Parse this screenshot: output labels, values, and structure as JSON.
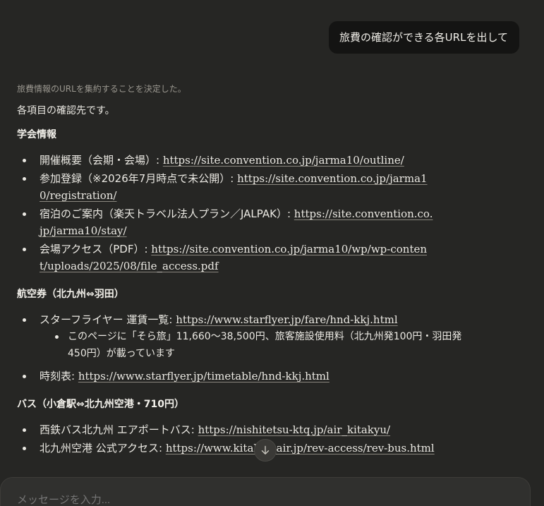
{
  "user_message": "旅費の確認ができる各URLを出して",
  "assistant": {
    "thinking_summary": "旅費情報のURLを集約することを決定した。",
    "intro": "各項目の確認先です。",
    "sections": [
      {
        "heading": "学会情報",
        "items": [
          {
            "label": "開催概要（会期・会場）: ",
            "url": "https://site.convention.co.jp/jarma10/outline/"
          },
          {
            "label": "参加登録（※2026年7月時点で未公開）: ",
            "url": "https://site.convention.co.jp/jarma10/registration/"
          },
          {
            "label": "宿泊のご案内（楽天トラベル法人プラン／JALPAK）: ",
            "url": "https://site.convention.co.jp/jarma10/stay/"
          },
          {
            "label": "会場アクセス（PDF）: ",
            "url": "https://site.convention.co.jp/jarma10/wp/wp-content/uploads/2025/08/file_access.pdf"
          }
        ]
      },
      {
        "heading": "航空券（北九州⇔羽田）",
        "items": [
          {
            "label": "スターフライヤー 運賃一覧: ",
            "url": "https://www.starflyer.jp/fare/hnd-kkj.html",
            "sub": "このページに「そら旅」11,660〜38,500円、旅客施設使用料（北九州発100円・羽田発450円）が載っています"
          },
          {
            "label": "時刻表: ",
            "url": "https://www.starflyer.jp/timetable/hnd-kkj.html"
          }
        ]
      },
      {
        "heading": "バス（小倉駅⇔北九州空港・710円）",
        "items": [
          {
            "label": "西鉄バス北九州 エアポートバス: ",
            "url": "https://nishitetsu-ktq.jp/air_kitakyu/"
          },
          {
            "label": "北九州空港 公式アクセス: ",
            "url": "https://www.kitakyu-air.jp/rev-access/rev-bus.html"
          }
        ]
      }
    ]
  },
  "composer": {
    "placeholder": "メッセージを入力..."
  },
  "icons": {
    "scroll_down": "arrow-down-icon"
  },
  "colors": {
    "background": "#262624",
    "user_bubble": "#141413",
    "text": "#ebe9e3",
    "muted": "#9a978f"
  }
}
